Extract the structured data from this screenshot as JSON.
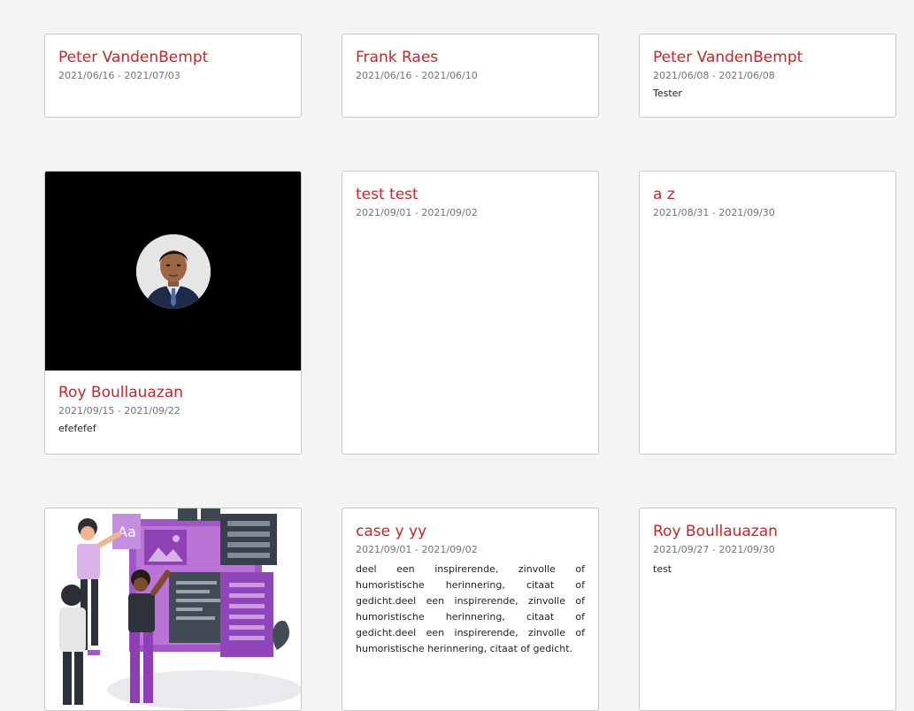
{
  "cards": [
    {
      "title": "Peter VandenBempt",
      "dates": "2021/06/16 - 2021/07/03",
      "text": ""
    },
    {
      "title": "Frank Raes",
      "dates": "2021/06/16 - 2021/06/10",
      "text": ""
    },
    {
      "title": "Peter VandenBempt",
      "dates": "2021/06/08 - 2021/06/08",
      "text": "Tester"
    },
    {
      "title": "Roy Boullauazan",
      "dates": "2021/09/15 - 2021/09/22",
      "text": "efefefef"
    },
    {
      "title": "test test",
      "dates": "2021/09/01 - 2021/09/02",
      "text": ""
    },
    {
      "title": "a z",
      "dates": "2021/08/31 - 2021/09/30",
      "text": ""
    },
    {
      "title": "case y yy",
      "dates": "2021/09/01 - 2021/09/02",
      "text": "deel een inspirerende, zinvolle of humoristische herinnering, citaat of gedicht.deel een inspirerende, zinvolle of humoristische herinnering, citaat of gedicht.deel een inspirerende, zinvolle of humoristische herinnering, citaat of gedicht."
    },
    {
      "title": "Roy Boullauazan",
      "dates": "2021/09/27 - 2021/09/30",
      "text": "test"
    }
  ],
  "colors": {
    "accent": "#c0282f",
    "muted": "#6c757d",
    "page_bg": "#f4f4f4"
  }
}
